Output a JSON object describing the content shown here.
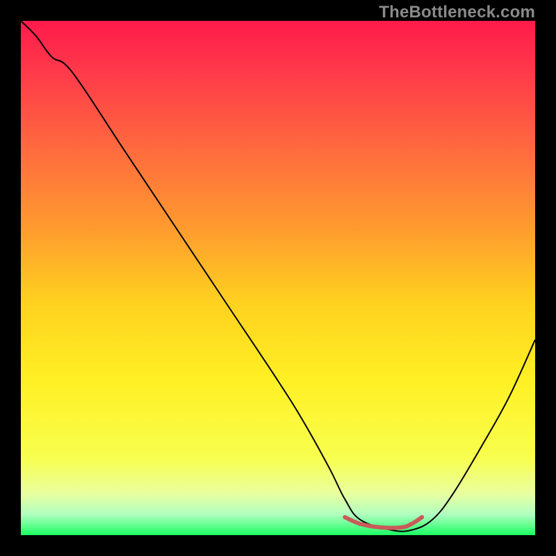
{
  "watermark": "TheBottleneck.com",
  "chart_data": {
    "type": "line",
    "title": "",
    "xlabel": "",
    "ylabel": "",
    "xlim": [
      0,
      100
    ],
    "ylim": [
      0,
      100
    ],
    "grid": false,
    "legend": false,
    "background": {
      "type": "vertical-gradient",
      "stops": [
        {
          "pos": 0.0,
          "color": "#ff1a4b"
        },
        {
          "pos": 0.1,
          "color": "#ff3a4a"
        },
        {
          "pos": 0.25,
          "color": "#ff6a3e"
        },
        {
          "pos": 0.4,
          "color": "#ff9a2f"
        },
        {
          "pos": 0.55,
          "color": "#ffd21f"
        },
        {
          "pos": 0.7,
          "color": "#fff024"
        },
        {
          "pos": 0.85,
          "color": "#f8ff4f"
        },
        {
          "pos": 0.92,
          "color": "#e8ffa0"
        },
        {
          "pos": 0.96,
          "color": "#b0ffc0"
        },
        {
          "pos": 1.0,
          "color": "#1aff62"
        }
      ]
    },
    "series": [
      {
        "name": "bottleneck-curve",
        "color": "#000000",
        "width": 2,
        "x": [
          0,
          3,
          6,
          10,
          20,
          30,
          40,
          50,
          55,
          60,
          63,
          66,
          72,
          76,
          80,
          84,
          90,
          95,
          100
        ],
        "y": [
          100,
          97,
          93,
          90,
          75,
          60,
          45,
          30,
          22,
          13,
          7,
          3,
          1,
          1,
          3,
          8,
          18,
          27,
          38
        ]
      },
      {
        "name": "optimal-zone",
        "color": "#ca5a5a",
        "width": 6,
        "x": [
          63,
          66,
          70,
          74,
          76,
          78
        ],
        "y": [
          3.5,
          2.2,
          1.5,
          1.5,
          2.2,
          3.5
        ]
      }
    ]
  }
}
